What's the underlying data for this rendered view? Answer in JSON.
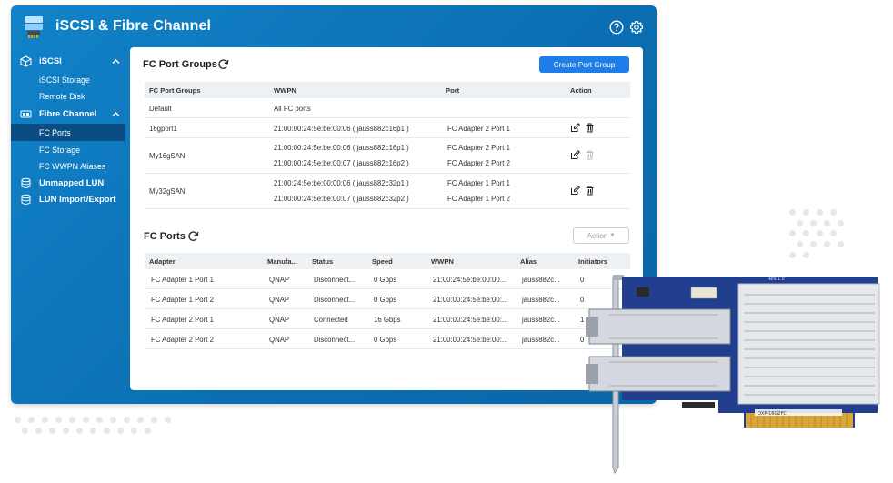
{
  "app": {
    "title": "iSCSI & Fibre Channel",
    "help_icon": "help-circle-icon",
    "settings_icon": "gear-icon"
  },
  "sidebar": {
    "groups": [
      {
        "label": "iSCSI",
        "icon": "iscsi-cube-icon",
        "expanded": true,
        "items": [
          {
            "label": "iSCSI Storage"
          },
          {
            "label": "Remote Disk"
          }
        ]
      },
      {
        "label": "Fibre Channel",
        "icon": "fibre-channel-icon",
        "expanded": true,
        "items": [
          {
            "label": "FC Ports",
            "active": true
          },
          {
            "label": "FC Storage"
          },
          {
            "label": "FC WWPN Aliases"
          }
        ]
      }
    ],
    "extra": [
      {
        "label": "Unmapped LUN",
        "icon": "database-icon"
      },
      {
        "label": "LUN Import/Export",
        "icon": "database-icon"
      }
    ]
  },
  "port_groups": {
    "title": "FC Port Groups",
    "create_button": "Create Port Group",
    "columns": [
      "FC Port Groups",
      "WWPN",
      "Port",
      "Action"
    ],
    "rows": [
      {
        "name": "Default",
        "wwpn": [
          "All FC ports"
        ],
        "port": [],
        "actions": false
      },
      {
        "name": "16gport1",
        "wwpn": [
          "21:00:00:24:5e:be:00:06 ( jauss882c16p1 )"
        ],
        "port": [
          "FC Adapter 2 Port 1"
        ],
        "actions": true,
        "delete_enabled": true
      },
      {
        "name": "My16gSAN",
        "wwpn": [
          "21:00:00:24:5e:be:00:06 ( jauss882c16p1 )",
          "21:00:00:24:5e:be:00:07 ( jauss882c16p2 )"
        ],
        "port": [
          "FC Adapter 2 Port 1",
          "FC Adapter 2 Port 2"
        ],
        "actions": true,
        "delete_enabled": false
      },
      {
        "name": "My32gSAN",
        "wwpn": [
          "21:00:24:5e:be:00:00:06 ( jauss882c32p1 )",
          "21:00:00:24:5e:be:00:07 ( jauss882c32p2 )"
        ],
        "port": [
          "FC Adapter 1 Port 1",
          "FC Adapter 1 Port 2"
        ],
        "actions": true,
        "delete_enabled": true
      }
    ]
  },
  "fc_ports": {
    "title": "FC Ports",
    "action_button": "Action",
    "columns": [
      "Adapter",
      "Manufa...",
      "Status",
      "Speed",
      "WWPN",
      "Alias",
      "Initiators"
    ],
    "rows": [
      {
        "adapter": "FC Adapter 1 Port 1",
        "manufacturer": "QNAP",
        "status": "Disconnect...",
        "speed": "0 Gbps",
        "wwpn": "21:00:24:5e:be:00:00...",
        "alias": "jauss882c...",
        "initiators": "0"
      },
      {
        "adapter": "FC Adapter 1 Port 2",
        "manufacturer": "QNAP",
        "status": "Disconnect...",
        "speed": "0 Gbps",
        "wwpn": "21:00:00:24:5e:be:00:...",
        "alias": "jauss882c...",
        "initiators": "0"
      },
      {
        "adapter": "FC Adapter 2 Port 1",
        "manufacturer": "QNAP",
        "status": "Connected",
        "speed": "16 Gbps",
        "wwpn": "21:00:00:24:5e:be:00:...",
        "alias": "jauss882c...",
        "initiators": "1"
      },
      {
        "adapter": "FC Adapter 2 Port 2",
        "manufacturer": "QNAP",
        "status": "Disconnect...",
        "speed": "0 Gbps",
        "wwpn": "21:00:00:24:5e:be:00:...",
        "alias": "jauss882c...",
        "initiators": "0"
      }
    ]
  },
  "hardware": {
    "rev_label": "Rev:1.0",
    "board_label": "QXP-16G2FC"
  },
  "colors": {
    "app_blue": "#0b6fb3",
    "sidebar_active": "#0b4d82",
    "primary_button": "#1e7de6",
    "pcb_blue": "#1f3f8f",
    "gold_contacts": "#d9a63a"
  }
}
